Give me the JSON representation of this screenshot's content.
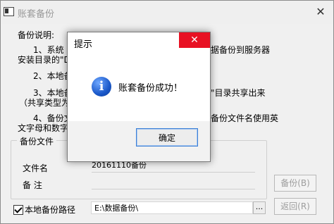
{
  "window": {
    "title": "账套备份",
    "close": "✕"
  },
  "instructions": {
    "heading": "备份说明:",
    "line1a": "1、系统",
    "line1b": "据备份到服务器",
    "line1c": "安装目录的\"D",
    "line2": "2、本地备",
    "line3a": "3、本地备",
    "line3b": "\"目录共享出来",
    "line3c": "（共享类型为",
    "line4a": "4、备份文",
    "line4b": "备份文件名使用英",
    "line4c": "文字母和数字"
  },
  "group": {
    "title": "备份文件",
    "filename_label": "文件名",
    "filename_value": "20161110备份",
    "note_label": "备  注",
    "note_value": ""
  },
  "buttons": {
    "backup": "备份(B)",
    "back": "返回(R)",
    "browse": "..."
  },
  "local_path": {
    "label": "本地备份路径",
    "checked": true,
    "value": "E:\\数据备份\\"
  },
  "dialog": {
    "title": "提示",
    "close": "✕",
    "icon": "info-icon",
    "message": "账套备份成功！",
    "ok": "确定"
  },
  "colors": {
    "close_red": "#e81123",
    "info_blue": "#1a58c9"
  }
}
